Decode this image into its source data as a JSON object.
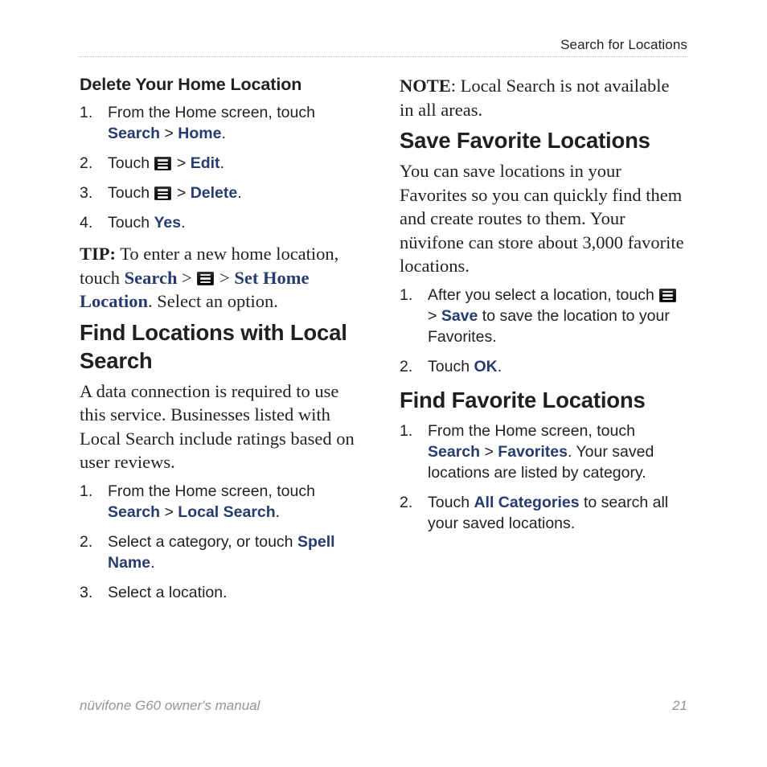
{
  "header": {
    "running_title": "Search for Locations"
  },
  "footer": {
    "manual_title": "nüvifone G60 owner's manual",
    "page_number": "21"
  },
  "icons": {
    "menu": "menu-icon"
  },
  "colors": {
    "ui_term_blue": "#263b6e",
    "body_text": "#231f20",
    "footer_gray": "#939598",
    "rule_gray": "#b3b3b3"
  },
  "left_column": {
    "subsection_1": {
      "heading": "Delete Your Home Location",
      "steps": [
        {
          "num": "1.",
          "parts": [
            {
              "t": "text",
              "v": "From the Home screen, touch "
            },
            {
              "t": "ui",
              "v": "Search"
            },
            {
              "t": "gt",
              "v": " > "
            },
            {
              "t": "ui",
              "v": "Home"
            },
            {
              "t": "text",
              "v": "."
            }
          ]
        },
        {
          "num": "2.",
          "parts": [
            {
              "t": "text",
              "v": "Touch "
            },
            {
              "t": "icon",
              "v": "menu-icon"
            },
            {
              "t": "gt",
              "v": " > "
            },
            {
              "t": "ui",
              "v": "Edit"
            },
            {
              "t": "text",
              "v": "."
            }
          ]
        },
        {
          "num": "3.",
          "parts": [
            {
              "t": "text",
              "v": "Touch "
            },
            {
              "t": "icon",
              "v": "menu-icon"
            },
            {
              "t": "gt",
              "v": " > "
            },
            {
              "t": "ui",
              "v": "Delete"
            },
            {
              "t": "text",
              "v": "."
            }
          ]
        },
        {
          "num": "4.",
          "parts": [
            {
              "t": "text",
              "v": "Touch "
            },
            {
              "t": "ui",
              "v": "Yes"
            },
            {
              "t": "text",
              "v": "."
            }
          ]
        }
      ]
    },
    "tip": {
      "lead": "TIP:",
      "parts": [
        {
          "t": "text",
          "v": " To enter a new home location, touch "
        },
        {
          "t": "ui",
          "v": "Search"
        },
        {
          "t": "gt",
          "v": " > "
        },
        {
          "t": "icon",
          "v": "menu-icon"
        },
        {
          "t": "gt",
          "v": " > "
        },
        {
          "t": "ui",
          "v": "Set Home Location"
        },
        {
          "t": "text",
          "v": ". Select an option."
        }
      ]
    },
    "section_1": {
      "heading": "Find Locations with Local Search",
      "paragraph": "A data connection is required to use this service. Businesses listed with Local Search include ratings based on user reviews.",
      "steps": [
        {
          "num": "1.",
          "parts": [
            {
              "t": "text",
              "v": "From the Home screen, touch "
            },
            {
              "t": "ui",
              "v": "Search"
            },
            {
              "t": "gt",
              "v": " > "
            },
            {
              "t": "ui",
              "v": "Local Search"
            },
            {
              "t": "text",
              "v": "."
            }
          ]
        },
        {
          "num": "2.",
          "parts": [
            {
              "t": "text",
              "v": "Select a category, or touch "
            },
            {
              "t": "ui",
              "v": "Spell Name"
            },
            {
              "t": "text",
              "v": "."
            }
          ]
        },
        {
          "num": "3.",
          "parts": [
            {
              "t": "text",
              "v": "Select a location."
            }
          ]
        }
      ]
    }
  },
  "right_column": {
    "note": {
      "lead": "NOTE",
      "text": ": Local Search is not available in all areas."
    },
    "section_1": {
      "heading": "Save Favorite Locations",
      "paragraph": "You can save locations in your Favorites so you can quickly find them and create routes to them. Your nüvifone can store about 3,000 favorite locations.",
      "steps": [
        {
          "num": "1.",
          "parts": [
            {
              "t": "text",
              "v": "After you select a location, touch "
            },
            {
              "t": "icon",
              "v": "menu-icon"
            },
            {
              "t": "gt",
              "v": " > "
            },
            {
              "t": "ui",
              "v": "Save"
            },
            {
              "t": "text",
              "v": " to save the location to your Favorites."
            }
          ]
        },
        {
          "num": "2.",
          "parts": [
            {
              "t": "text",
              "v": "Touch "
            },
            {
              "t": "ui",
              "v": "OK"
            },
            {
              "t": "text",
              "v": "."
            }
          ]
        }
      ]
    },
    "section_2": {
      "heading": "Find Favorite Locations",
      "steps": [
        {
          "num": "1.",
          "parts": [
            {
              "t": "text",
              "v": "From the Home screen, touch "
            },
            {
              "t": "ui",
              "v": "Search"
            },
            {
              "t": "gt",
              "v": " > "
            },
            {
              "t": "ui",
              "v": "Favorites"
            },
            {
              "t": "text",
              "v": ". Your saved locations are listed by category."
            }
          ]
        },
        {
          "num": "2.",
          "parts": [
            {
              "t": "text",
              "v": "Touch "
            },
            {
              "t": "ui",
              "v": "All Categories"
            },
            {
              "t": "text",
              "v": " to search all your saved locations."
            }
          ]
        }
      ]
    }
  }
}
